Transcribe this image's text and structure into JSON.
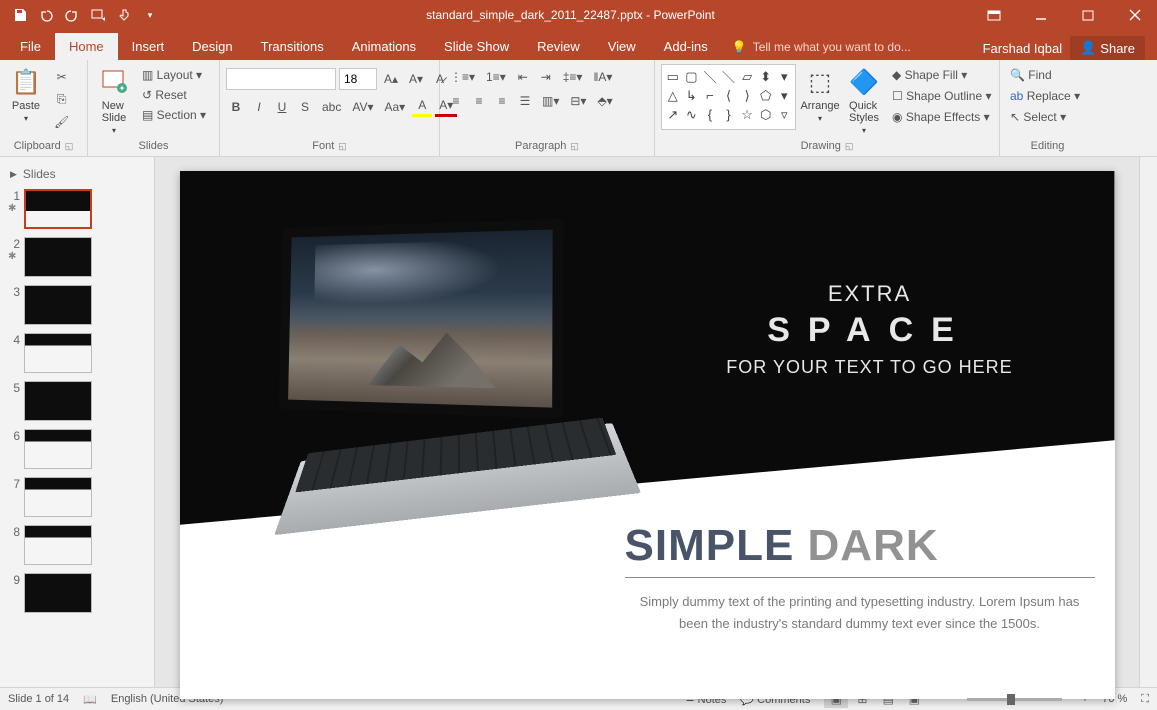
{
  "title": {
    "filename": "standard_simple_dark_2011_22487.pptx",
    "app": "PowerPoint"
  },
  "user": "Farshad Iqbal",
  "share": "Share",
  "tabs": {
    "file": "File",
    "home": "Home",
    "insert": "Insert",
    "design": "Design",
    "transitions": "Transitions",
    "animations": "Animations",
    "slideshow": "Slide Show",
    "review": "Review",
    "view": "View",
    "addins": "Add-ins",
    "tellme": "Tell me what you want to do..."
  },
  "ribbon": {
    "clipboard": {
      "label": "Clipboard",
      "paste": "Paste"
    },
    "slides": {
      "label": "Slides",
      "new": "New\nSlide",
      "layout": "Layout",
      "reset": "Reset",
      "section": "Section"
    },
    "font": {
      "label": "Font",
      "size": "18"
    },
    "paragraph": {
      "label": "Paragraph"
    },
    "drawing": {
      "label": "Drawing",
      "arrange": "Arrange",
      "quick": "Quick\nStyles",
      "fill": "Shape Fill",
      "outline": "Shape Outline",
      "effects": "Shape Effects"
    },
    "editing": {
      "label": "Editing",
      "find": "Find",
      "replace": "Replace",
      "select": "Select"
    }
  },
  "thumbs": {
    "header": "Slides",
    "count": 9
  },
  "slide": {
    "top1": "EXTRA",
    "top2": "SPACE",
    "top3": "FOR YOUR TEXT TO GO HERE",
    "title1": "SIMPLE",
    "title2": "DARK",
    "body": "Simply dummy text of the printing and typesetting industry. Lorem Ipsum has been the industry's standard dummy text ever since the 1500s."
  },
  "status": {
    "slide": "Slide 1 of 14",
    "lang": "English (United States)",
    "notes": "Notes",
    "comments": "Comments",
    "zoom": "70 %"
  }
}
